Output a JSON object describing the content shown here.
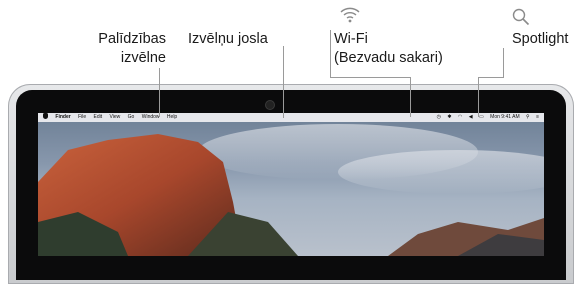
{
  "callouts": {
    "help_menu": {
      "line1": "Palīdzības",
      "line2": "izvēlne"
    },
    "menu_bar": "Izvēlņu josla",
    "wifi": {
      "line1": "Wi-Fi",
      "line2": "(Bezvadu sakari)"
    },
    "spotlight": "Spotlight"
  },
  "menubar": {
    "items": [
      "Finder",
      "File",
      "Edit",
      "View",
      "Go",
      "Window",
      "Help"
    ],
    "clock": "Mon 9:41 AM"
  },
  "colors": {
    "leader": "#9a9a9a",
    "wifi_icon": "#8a8a8a"
  }
}
